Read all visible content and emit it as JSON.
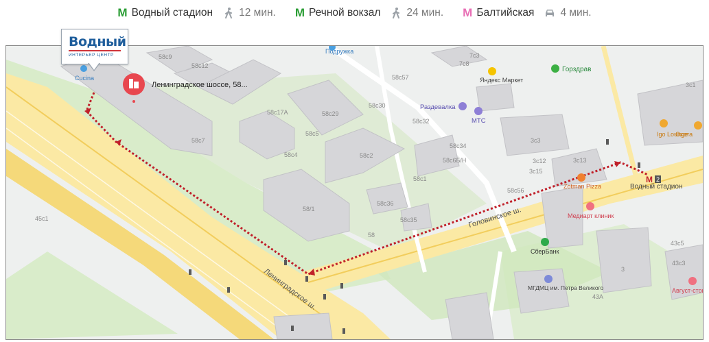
{
  "transit": [
    {
      "line_color": "#2a9d34",
      "station": "Водный стадион",
      "mode": "walk",
      "duration": "12 мин."
    },
    {
      "line_color": "#2a9d34",
      "station": "Речной вокзал",
      "mode": "walk",
      "duration": "24 мин."
    },
    {
      "line_color": "#e86fb5",
      "station": "Балтийская",
      "mode": "car",
      "duration": "4 мин."
    }
  ],
  "colors": {
    "route": "#c0202a",
    "pin": "#e8474f",
    "metro_green": "#2a9d34",
    "metro_pink": "#e86fb5",
    "park": "#d9ecca",
    "road": "#fbe9a4"
  },
  "map": {
    "logo": {
      "title": "Водный",
      "subtitle": "ИНТЕРЬЕР ЦЕНТР"
    },
    "destination": "Ленинградское шоссе, 58...",
    "station": {
      "name": "Водный стадион",
      "marker": "М",
      "exit": "2"
    },
    "streets": [
      "Ленинградское ш.",
      "Головинское ш."
    ],
    "pois": [
      "Подружка",
      "Яндекс Маркет",
      "Горздрав",
      "Раздевалка",
      "МТС",
      "Igo Lounge",
      "Охота",
      "Zotman Pizza",
      "Медиарт клиник",
      "СберБанк",
      "МГДМЦ им. Петра Великого",
      "Август-стом",
      "Cucina"
    ],
    "houses": [
      "58с9",
      "58с12",
      "58с17А",
      "58с29",
      "58с30",
      "58с32",
      "58с34",
      "58с2",
      "58с5",
      "58с4",
      "58с7",
      "58/1",
      "58с36",
      "58с35",
      "58",
      "58с1",
      "58с6Б/Н",
      "58с57",
      "58с56",
      "7с3",
      "7с8",
      "3с3",
      "3с12",
      "3с13",
      "3с15",
      "43с5",
      "43с3",
      "43А",
      "3с1",
      "45с1",
      "3"
    ]
  }
}
